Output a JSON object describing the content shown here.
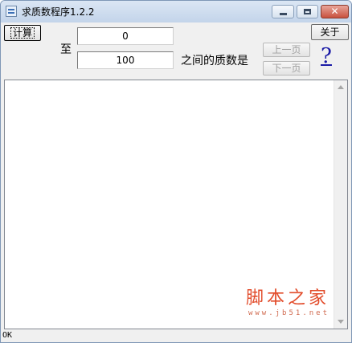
{
  "window": {
    "title": "求质数程序1.2.2",
    "close_glyph": "✕"
  },
  "toolbar": {
    "calc_label": "计算",
    "about_label": "关于",
    "prev_label": "上一页",
    "next_label": "下一页",
    "help_label": "?"
  },
  "range": {
    "from_value": "0",
    "to_label": "至",
    "to_value": "100",
    "between_label": "之间的质数是"
  },
  "watermark": {
    "main": "脚本之家",
    "sub": "www.jb51.net"
  },
  "status": {
    "text": "OK"
  },
  "colors": {
    "title_bar": "#c3d4ea",
    "help_link": "#1a1aa6",
    "watermark": "#e24c2b"
  }
}
